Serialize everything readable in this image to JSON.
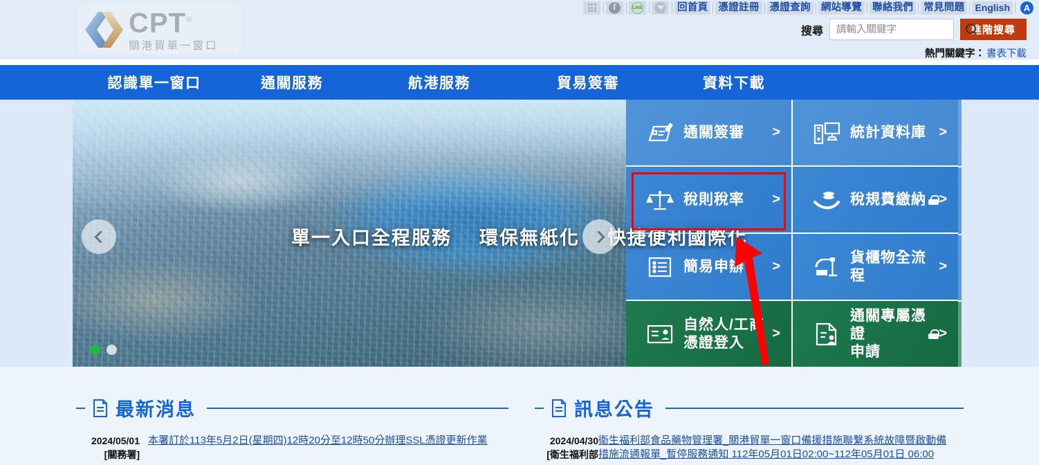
{
  "topbar": {
    "icons": [
      {
        "name": "app-grid-icon",
        "label": "sitemap-grid"
      },
      {
        "name": "facebook-icon",
        "label": "f"
      },
      {
        "name": "line-icon",
        "label": "LINE"
      },
      {
        "name": "share-dropdown-icon",
        "label": "share"
      }
    ],
    "links": [
      {
        "label": "回首頁"
      },
      {
        "label": "憑證註冊"
      },
      {
        "label": "憑證查詢"
      },
      {
        "label": "網站導覽"
      },
      {
        "label": "聯絡我們"
      },
      {
        "label": "常見問題"
      },
      {
        "label": "English"
      }
    ],
    "accessibility_badge": "A"
  },
  "logo": {
    "brand": "CPT",
    "registered": "®",
    "subtitle": "關港貿單一窗口"
  },
  "search": {
    "label": "搜尋",
    "placeholder": "請輸入關鍵字",
    "value": "",
    "advanced_button": "進階搜尋",
    "hot_label": "熱門關鍵字：",
    "hot_keyword": "書表下載"
  },
  "mainnav": {
    "items": [
      {
        "label": "認識單一窗口"
      },
      {
        "label": "通關服務"
      },
      {
        "label": "航港服務"
      },
      {
        "label": "貿易簽審"
      },
      {
        "label": "資料下載"
      }
    ]
  },
  "carousel": {
    "captions": [
      "單一入口全程服務",
      "環保無紙化",
      "快捷便利國際化"
    ],
    "prev_label": "‹",
    "next_label": "›",
    "dots": [
      {
        "active": true
      },
      {
        "active": false
      }
    ]
  },
  "tiles": [
    {
      "label": "通關簽審",
      "arrow": ">",
      "icon": "form-pen-icon",
      "theme": "blue",
      "locked": false,
      "highlighted": false
    },
    {
      "label": "統計資料庫",
      "arrow": ">",
      "icon": "computer-icon",
      "theme": "blue",
      "locked": false,
      "highlighted": false
    },
    {
      "label": "稅則稅率",
      "arrow": ">",
      "icon": "scale-balance-icon",
      "theme": "blue2",
      "locked": false,
      "highlighted": true
    },
    {
      "label": "稅規費繳納",
      "arrow": ">",
      "icon": "hand-coins-icon",
      "theme": "blue2",
      "locked": true,
      "highlighted": false
    },
    {
      "label": "簡易申辦",
      "arrow": ">",
      "icon": "list-icon",
      "theme": "blue2",
      "locked": false,
      "highlighted": false
    },
    {
      "label": "貨櫃物全流程",
      "arrow": ">",
      "icon": "crane-container-icon",
      "theme": "blue2",
      "locked": false,
      "highlighted": false
    },
    {
      "label": "自然人/工商\n憑證登入",
      "arrow": ">",
      "icon": "id-card-icon",
      "theme": "green",
      "locked": false,
      "highlighted": false
    },
    {
      "label": "通關專屬憑證\n申請",
      "arrow": ">",
      "icon": "certificate-stamp-icon",
      "theme": "green",
      "locked": true,
      "highlighted": false
    }
  ],
  "panels": {
    "left": {
      "title": "最新消息",
      "icon": "document-icon",
      "items": [
        {
          "date": "2024/05/01",
          "source": "[關務署]",
          "text": "本署訂於113年5月2日(星期四)12時20分至12時50分辦理SSL憑證更新作業"
        }
      ]
    },
    "right": {
      "title": "訊息公告",
      "icon": "document-icon",
      "items": [
        {
          "date": "2024/04/30",
          "source": "[衛生福利部",
          "text": "衛生福利部食品藥物管理署_關港貿單一窗口備援措施聯繫系統故障暨啟動備",
          "text2": "措施流通報單_暫停服務通知 112年05月01日02:00~112年05月01日 06:00"
        }
      ]
    }
  },
  "annotations": {
    "highlight_target": "稅則稅率",
    "arrow_color": "#ff0000",
    "rect_color": "#ff0000"
  },
  "colors": {
    "nav_blue": "#1565d8",
    "tile_blue": "#4a8ed6",
    "tile_blue_dark": "#3581d0",
    "tile_green": "#197046",
    "accent_red": "#c13a0e",
    "page_bg": "#dde9f8",
    "link_blue": "#1d4ea8"
  }
}
